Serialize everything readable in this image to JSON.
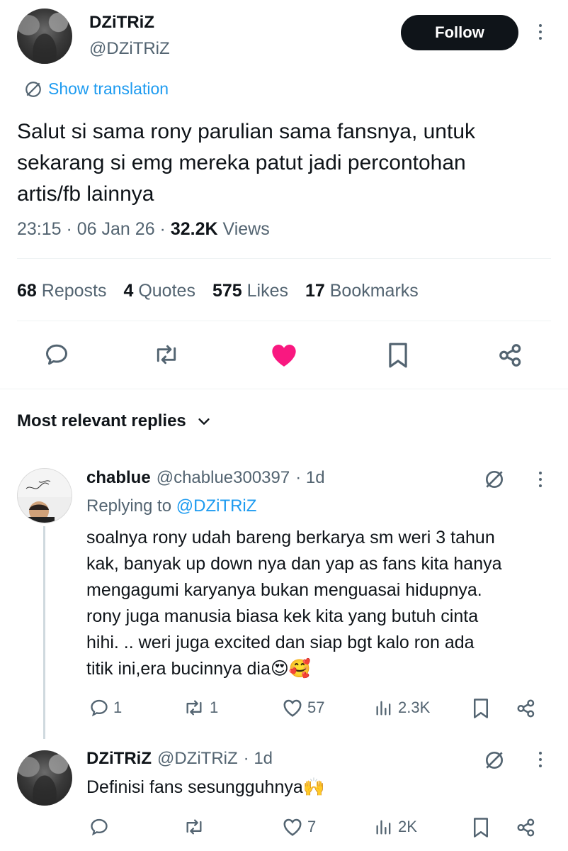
{
  "tweet": {
    "author_name": "DZiTRiZ",
    "author_handle": "@DZiTRiZ",
    "follow_label": "Follow",
    "translation_label": "Show translation",
    "text_lines": [
      "Salut si sama rony parulian sama fansnya, untuk",
      "sekarang si emg mereka patut jadi percontohan",
      "artis/fb lainnya"
    ],
    "time": "23:15 · 06 Jan 26 · ",
    "views_count": "32.2K",
    "views_label": " Views",
    "stats": {
      "reposts_count": "68",
      "reposts_label": " Reposts",
      "quotes_count": "4",
      "quotes_label": " Quotes",
      "likes_count": "575",
      "likes_label": " Likes",
      "bookmarks_count": "17",
      "bookmarks_label": " Bookmarks"
    }
  },
  "replies_header": "Most relevant replies",
  "replies": [
    {
      "name": "chablue",
      "handle": "@chablue300397",
      "time": "· 1d",
      "replying_prefix": "Replying to ",
      "replying_handle": "@DZiTRiZ",
      "lines": [
        "soalnya rony udah bareng berkarya sm weri 3 tahun",
        "kak, banyak up down nya dan yap as fans kita hanya",
        "mengagumi karyanya bukan menguasai hidupnya.",
        "rony juga manusia biasa kek kita yang butuh cinta",
        "hihi. .. weri juga excited dan siap bgt kalo ron ada",
        "titik ini,era bucinnya dia😍🥰"
      ],
      "replies_count": "1",
      "reposts_count": "1",
      "likes_count": "57",
      "views_count": "2.3K"
    },
    {
      "name": "DZiTRiZ",
      "handle": "@DZiTRiZ",
      "time": "· 1d",
      "text": "Definisi fans sesungguhnya🙌",
      "replies_count": "",
      "reposts_count": "",
      "likes_count": "7",
      "views_count": "2K"
    }
  ],
  "colors": {
    "like_active": "#f91880",
    "link": "#1d9bf0",
    "muted": "#536471"
  }
}
